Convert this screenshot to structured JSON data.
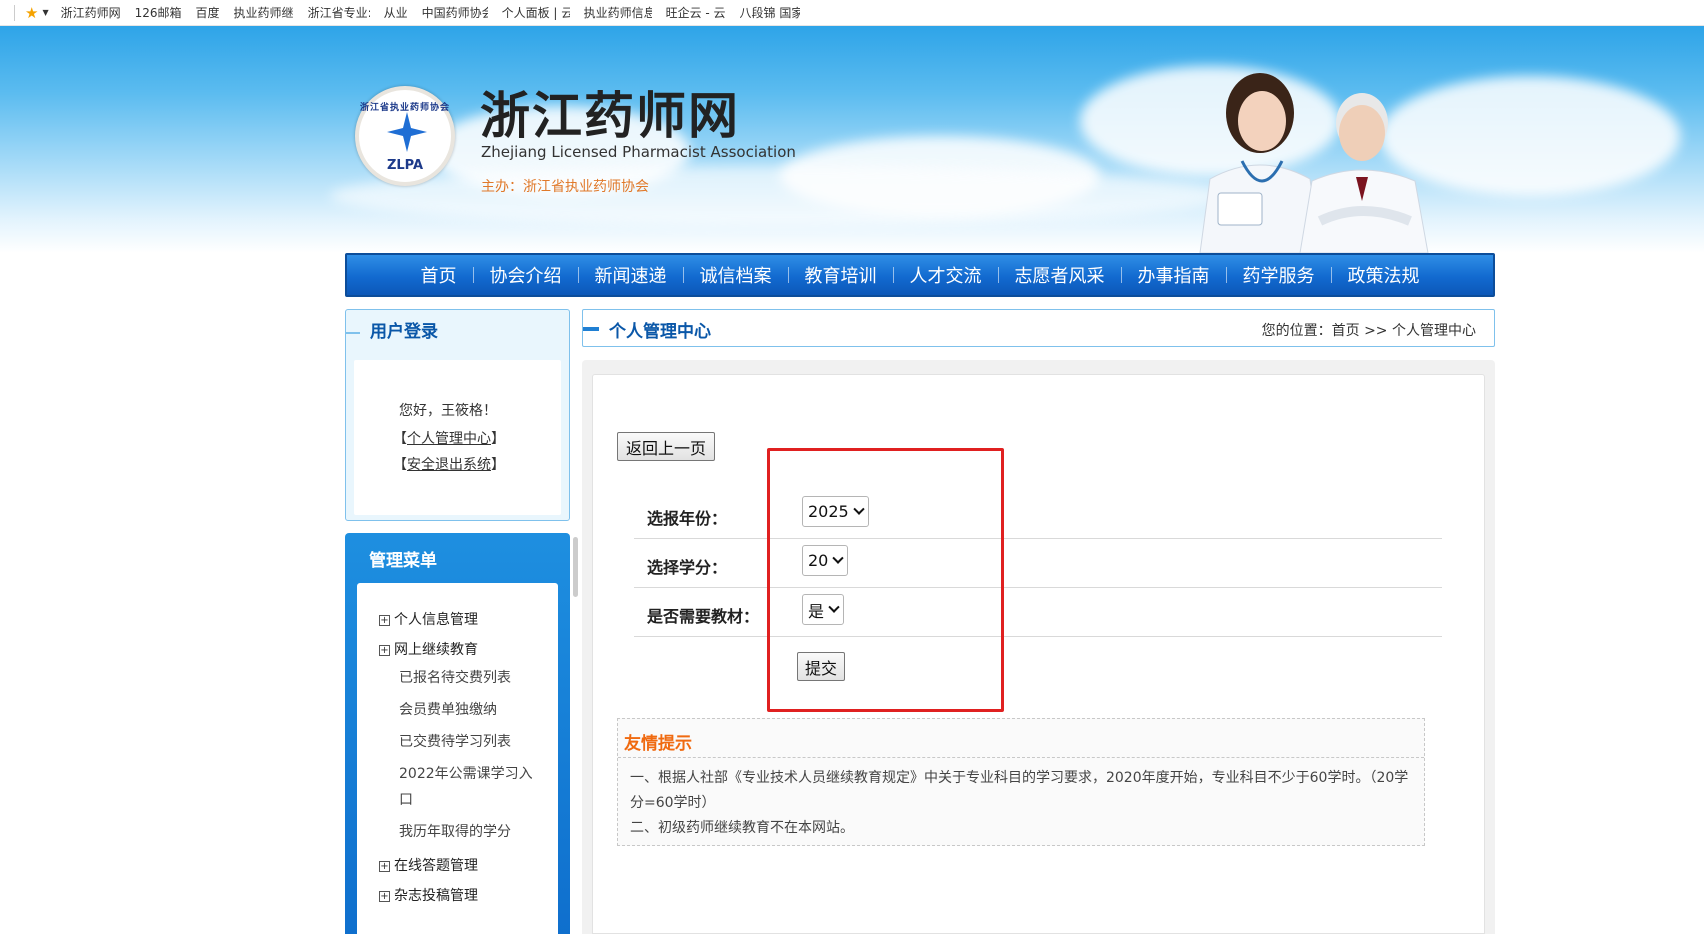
{
  "bookmarks": [
    "浙江药师网",
    "126邮箱",
    "百度",
    "执业药师继",
    "浙江省专业:",
    "从业",
    "中国药师协会",
    "个人面板 | 云",
    "执业药师信息",
    "旺企云 - 云",
    "八段锦 国家"
  ],
  "header": {
    "title": "浙江药师网",
    "subtitle": "Zhejiang Licensed Pharmacist Association",
    "host": "主办：浙江省执业药师协会",
    "logo_ring": "浙江省执业药师协会",
    "logo_abbr": "ZLPA"
  },
  "nav": [
    "首页",
    "协会介绍",
    "新闻速递",
    "诚信档案",
    "教育培训",
    "人才交流",
    "志愿者风采",
    "办事指南",
    "药学服务",
    "政策法规"
  ],
  "login": {
    "title": "用户登录",
    "greeting": "您好，王筱格！",
    "personal_center": "个人管理中心",
    "logout": "安全退出系统",
    "bracket_open": "【",
    "bracket_close": "】"
  },
  "menu": {
    "title": "管理菜单",
    "items": [
      {
        "label": "个人信息管理",
        "type": "group",
        "icon": "plus-box-icon"
      },
      {
        "label": "网上继续教育",
        "type": "group",
        "icon": "plus-box-icon"
      },
      {
        "label": "已报名待交费列表",
        "type": "sub"
      },
      {
        "label": "会员费单独缴纳",
        "type": "sub"
      },
      {
        "label": "已交费待学习列表",
        "type": "sub"
      },
      {
        "label": "2022年公需课学习入口",
        "type": "sub"
      },
      {
        "label": "我历年取得的学分",
        "type": "sub"
      },
      {
        "label": "在线答题管理",
        "type": "group",
        "icon": "plus-box-icon"
      },
      {
        "label": "杂志投稿管理",
        "type": "group",
        "icon": "plus-box-icon"
      }
    ]
  },
  "breadcrumb": {
    "title": "个人管理中心",
    "location_label": "您的位置：",
    "home": "首页",
    "separator": " >> ",
    "current": "个人管理中心"
  },
  "form": {
    "back_button": "返回上一页",
    "year_label": "选报年份：",
    "year_value": "2025",
    "credit_label": "选择学分：",
    "credit_value": "20",
    "material_label": "是否需要教材：",
    "material_value": "是",
    "submit_button": "提交"
  },
  "tips": {
    "title": "友情提示",
    "line1": "一、根据人社部《专业技术人员继续教育规定》中关于专业科目的学习要求，2020年度开始，专业科目不少于60学时。（20学分=60学时）",
    "line2": "二、初级药师继续教育不在本网站。"
  },
  "colors": {
    "nav_blue": "#126ad0",
    "title_blue": "#0a57a8",
    "tips_orange": "#f06a10",
    "highlight_red": "#e02020"
  }
}
